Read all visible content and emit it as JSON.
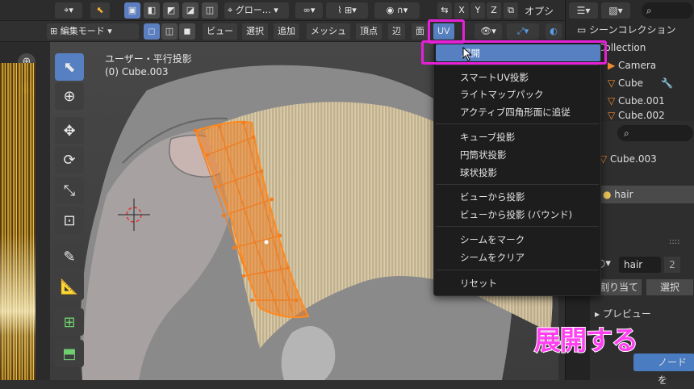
{
  "header": {
    "transform_orientation": "グロー…",
    "axes": [
      "X",
      "Y",
      "Z"
    ],
    "options_label": "オプシ"
  },
  "mode_bar": {
    "mode": "編集モード",
    "menus": [
      "ビュー",
      "選択",
      "追加",
      "メッシュ",
      "頂点",
      "辺",
      "面",
      "UV"
    ]
  },
  "viewport": {
    "view_name": "ユーザー・平行投影",
    "object_name": "(0) Cube.003"
  },
  "uv_menu": {
    "items": [
      "展開",
      "スマートUV投影",
      "ライトマップパック",
      "アクティブ四角形面に追従",
      "キューブ投影",
      "円筒状投影",
      "球状投影",
      "ビューから投影",
      "ビューから投影 (バウンド)",
      "シームをマーク",
      "シームをクリア",
      "リセット"
    ],
    "highlighted_index": 0
  },
  "outliner": {
    "title": "シーンコレクション",
    "items": [
      "Collection",
      "Camera",
      "Cube",
      "Cube.001",
      "Cube.002"
    ]
  },
  "properties": {
    "object": "Cube.003",
    "material_slot": "hair",
    "material_name": "hair",
    "user_count": "2",
    "assign_label": "割り当て",
    "select_label": "選択",
    "preview_label": "プレビュー",
    "node_button": "ノードを"
  },
  "caption": "展開する",
  "colors": {
    "highlight": "#e620d7",
    "menu_active": "#5680c2",
    "mesh_orange": "#f07d21"
  }
}
